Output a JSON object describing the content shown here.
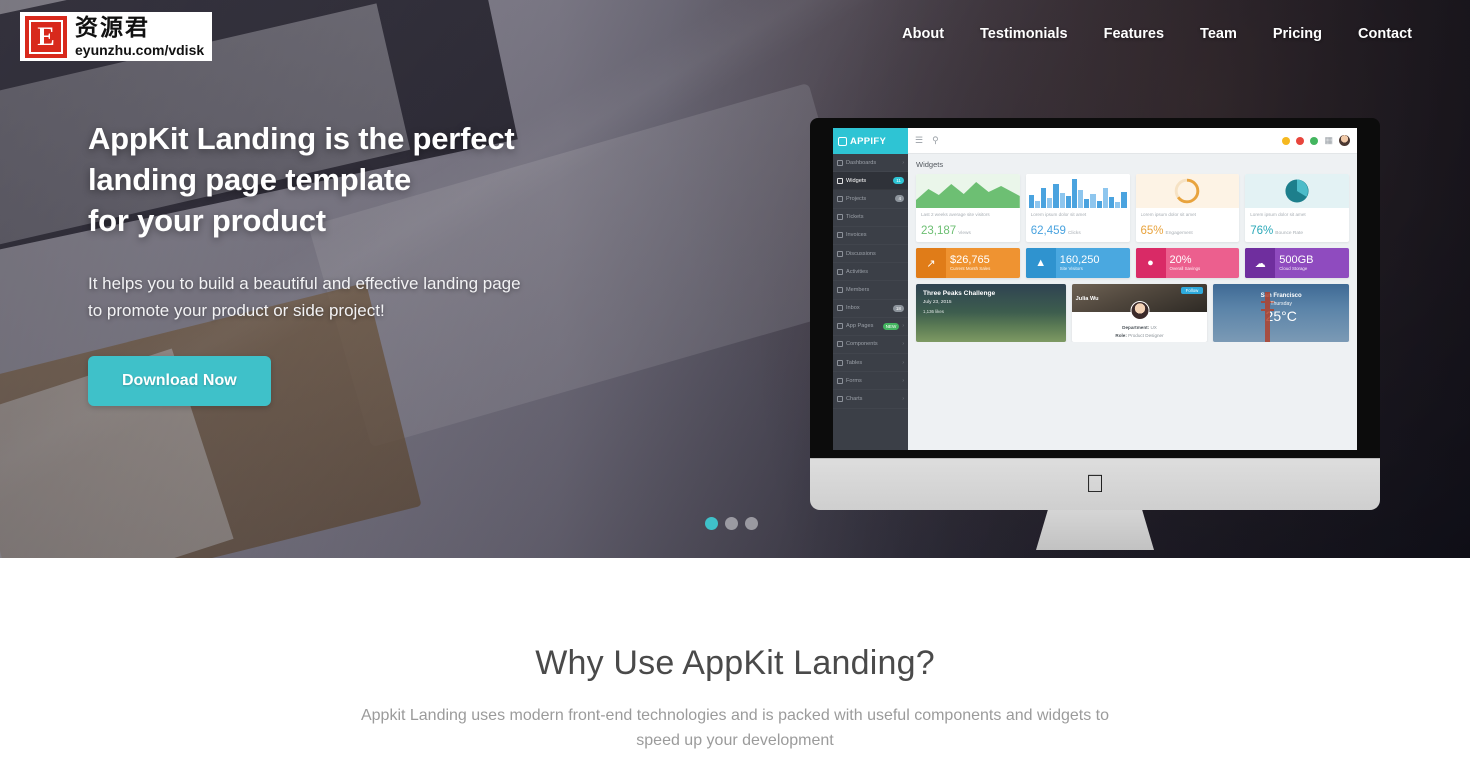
{
  "watermark": {
    "mark_letter": "E",
    "cn_text": "资源君",
    "url_text": "eyunzhu.com/vdisk"
  },
  "nav": {
    "items": [
      {
        "label": "About"
      },
      {
        "label": "Testimonials"
      },
      {
        "label": "Features"
      },
      {
        "label": "Team"
      },
      {
        "label": "Pricing"
      },
      {
        "label": "Contact"
      }
    ]
  },
  "hero": {
    "headline_line1": "AppKit Landing is the perfect",
    "headline_line2": "landing page template",
    "headline_line3": "for your product",
    "subtext_line1": "It helps you to build a beautiful and effective landing page",
    "subtext_line2": "to promote your product or side project!",
    "cta_label": "Download Now",
    "cta_color": "#3fc1c9",
    "carousel": {
      "total": 3,
      "active_index": 0
    }
  },
  "dashboard": {
    "brand": "APPIFY",
    "brand_color": "#2ec4d4",
    "topbar": {
      "menu_icon": "list-icon",
      "search_icon": "search-icon",
      "badges": [
        "#f5b820",
        "#e8453c",
        "#43b55f"
      ],
      "grid_icon": "grid-icon",
      "avatar": "user-avatar"
    },
    "page_title": "Widgets",
    "sidebar": [
      {
        "label": "Dashboards",
        "badge": "",
        "badge_color": "",
        "arrow": "›",
        "active": false
      },
      {
        "label": "Widgets",
        "badge": "11",
        "badge_color": "#2ec4d4",
        "arrow": "",
        "active": true
      },
      {
        "label": "Projects",
        "badge": "4",
        "badge_color": "#8d949c",
        "arrow": "",
        "active": false
      },
      {
        "label": "Tickets",
        "badge": "",
        "badge_color": "",
        "arrow": "",
        "active": false
      },
      {
        "label": "Invoices",
        "badge": "",
        "badge_color": "",
        "arrow": "",
        "active": false
      },
      {
        "label": "Discussions",
        "badge": "",
        "badge_color": "",
        "arrow": "",
        "active": false
      },
      {
        "label": "Activities",
        "badge": "",
        "badge_color": "",
        "arrow": "",
        "active": false
      },
      {
        "label": "Members",
        "badge": "",
        "badge_color": "",
        "arrow": "",
        "active": false
      },
      {
        "label": "Inbox",
        "badge": "18",
        "badge_color": "#8d949c",
        "arrow": "",
        "active": false
      },
      {
        "label": "App Pages",
        "badge": "NEW",
        "badge_color": "#43b55f",
        "arrow": "›",
        "active": false
      },
      {
        "label": "Components",
        "badge": "",
        "badge_color": "",
        "arrow": "›",
        "active": false
      },
      {
        "label": "Tables",
        "badge": "",
        "badge_color": "",
        "arrow": "›",
        "active": false
      },
      {
        "label": "Forms",
        "badge": "",
        "badge_color": "",
        "arrow": "›",
        "active": false
      },
      {
        "label": "Charts",
        "badge": "",
        "badge_color": "",
        "arrow": "›",
        "active": false
      }
    ],
    "widget_cards": [
      {
        "desc": "Last 2 weeks average site visitors",
        "value": "23,187",
        "unit": "Views",
        "color": "#6dbf73",
        "chart": "area"
      },
      {
        "desc": "Lorem ipsum dolor sit amet",
        "value": "62,459",
        "unit": "Clicks",
        "color": "#4aa3df",
        "chart": "bars"
      },
      {
        "desc": "Lorem ipsum dolor sit amet",
        "value": "65%",
        "unit": "Engagement",
        "color": "#e8a33d",
        "chart": "donut"
      },
      {
        "desc": "Lorem ipsum dolor sit amet",
        "value": "76%",
        "unit": "Bounce Rate",
        "color": "#2aa8b8",
        "chart": "pie"
      }
    ],
    "stat_tiles": [
      {
        "icon": "trend-icon",
        "value": "$26,765",
        "label": "Current Month Sales",
        "color": "#ef9331",
        "dark": "#e07c18"
      },
      {
        "icon": "bars-icon",
        "value": "160,250",
        "label": "Site Visitors",
        "color": "#4aa8e0",
        "dark": "#2f93cf"
      },
      {
        "icon": "piggy-icon",
        "value": "20%",
        "label": "Overall Savings",
        "color": "#ec5f8e",
        "dark": "#d92a66"
      },
      {
        "icon": "cloud-icon",
        "value": "500GB",
        "label": "Cloud Storage",
        "color": "#8f4bbf",
        "dark": "#6f2e9e"
      }
    ],
    "bottom_cards": {
      "peaks": {
        "title": "Three Peaks Challenge",
        "date": "July 23, 2015",
        "meta": "1,136 likes"
      },
      "profile": {
        "name": "Julia Wu",
        "follow_label": "Follow",
        "department_label": "Department:",
        "department_value": "UX",
        "role_label": "Role:",
        "role_value": "Product Designer"
      },
      "weather": {
        "city": "San Francisco",
        "day": "Thursday",
        "temp": "25°C"
      }
    }
  },
  "why": {
    "heading": "Why Use AppKit Landing?",
    "description_line1": "Appkit Landing uses modern front-end technologies and is packed with useful components and",
    "description_line2": "widgets to speed up your development"
  }
}
